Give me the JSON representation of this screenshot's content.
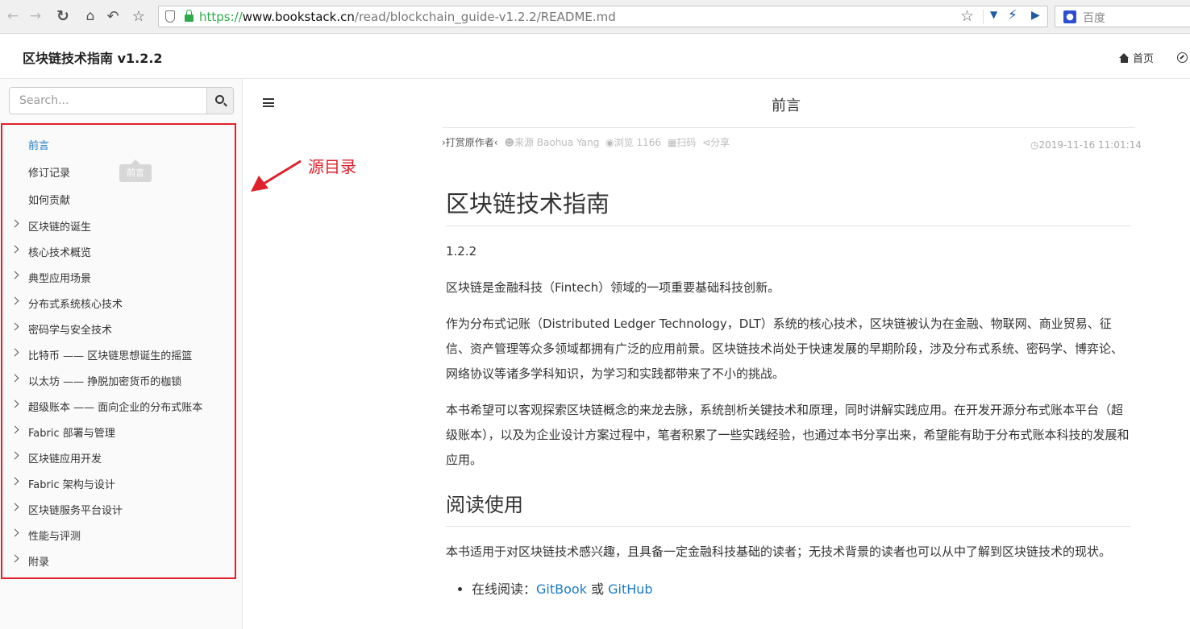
{
  "browser": {
    "url_protocol": "https://",
    "url_host": "www.bookstack.cn",
    "url_path": "/read/blockchain_guide-v1.2.2/README.md",
    "search_engine": "百度"
  },
  "header": {
    "book_title": "区块链技术指南 v1.2.2",
    "home_label": "首页"
  },
  "sidebar": {
    "search_placeholder": "Search...",
    "tooltip": "前言",
    "items": [
      {
        "label": "前言",
        "active": true,
        "expandable": false
      },
      {
        "label": "修订记录",
        "active": false,
        "expandable": false
      },
      {
        "label": "如何贡献",
        "active": false,
        "expandable": false
      },
      {
        "label": "区块链的诞生",
        "active": false,
        "expandable": true
      },
      {
        "label": "核心技术概览",
        "active": false,
        "expandable": true
      },
      {
        "label": "典型应用场景",
        "active": false,
        "expandable": true
      },
      {
        "label": "分布式系统核心技术",
        "active": false,
        "expandable": true
      },
      {
        "label": "密码学与安全技术",
        "active": false,
        "expandable": true
      },
      {
        "label": "比特币 —— 区块链思想诞生的摇篮",
        "active": false,
        "expandable": true
      },
      {
        "label": "以太坊 —— 挣脱加密货币的枷锁",
        "active": false,
        "expandable": true
      },
      {
        "label": "超级账本 —— 面向企业的分布式账本",
        "active": false,
        "expandable": true
      },
      {
        "label": "Fabric 部署与管理",
        "active": false,
        "expandable": true
      },
      {
        "label": "区块链应用开发",
        "active": false,
        "expandable": true
      },
      {
        "label": "Fabric 架构与设计",
        "active": false,
        "expandable": true
      },
      {
        "label": "区块链服务平台设计",
        "active": false,
        "expandable": true
      },
      {
        "label": "性能与评测",
        "active": false,
        "expandable": true
      },
      {
        "label": "附录",
        "active": false,
        "expandable": true
      }
    ]
  },
  "annotation": {
    "label": "源目录",
    "color": "#e0202a"
  },
  "main": {
    "page_title": "前言",
    "meta": {
      "reward": "›打赏原作者‹",
      "source": "来源 Baohua Yang",
      "views": "浏览 1166",
      "scan": "扫码",
      "share": "分享",
      "time": "2019-11-16 11:01:14"
    },
    "article": {
      "h1": "区块链技术指南",
      "version": "1.2.2",
      "p1": "区块链是金融科技（Fintech）领域的一项重要基础科技创新。",
      "p2": "作为分布式记账（Distributed Ledger Technology，DLT）系统的核心技术，区块链被认为在金融、物联网、商业贸易、征信、资产管理等众多领域都拥有广泛的应用前景。区块链技术尚处于快速发展的早期阶段，涉及分布式系统、密码学、博弈论、网络协议等诸多学科知识，为学习和实践都带来了不小的挑战。",
      "p3": "本书希望可以客观探索区块链概念的来龙去脉，系统剖析关键技术和原理，同时讲解实践应用。在开发开源分布式账本平台（超级账本），以及为企业设计方案过程中，笔者积累了一些实践经验，也通过本书分享出来，希望能有助于分布式账本科技的发展和应用。",
      "h2": "阅读使用",
      "p4": "本书适用于对区块链技术感兴趣，且具备一定金融科技基础的读者；无技术背景的读者也可以从中了解到区块链技术的现状。",
      "list_prefix": "在线阅读：",
      "link1": "GitBook",
      "list_or": " 或 ",
      "link2": "GitHub"
    }
  }
}
